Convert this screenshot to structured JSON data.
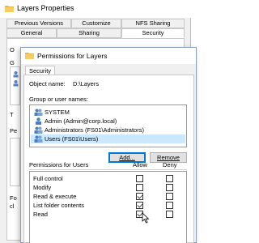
{
  "background_window": {
    "title": "Layers Properties",
    "tabs_row1": [
      "Previous Versions",
      "Customize",
      "NFS Sharing"
    ],
    "tabs_row2": [
      "General",
      "Sharing",
      "Security"
    ],
    "active_tab": "Security",
    "fragments": [
      "O",
      "G",
      "T",
      "Pe",
      "Fo",
      "cl"
    ]
  },
  "dialog": {
    "title": "Permissions for Layers",
    "tab": "Security",
    "object_name_label": "Object name:",
    "object_name_value": "D:\\Layers",
    "group_label": "Group or user names:",
    "principals": [
      "SYSTEM",
      "Admin (Admin@corp.local)",
      "Administrators (FS01\\Administrators)",
      "Users (FS01\\Users)"
    ],
    "selected_principal": "Users (FS01\\Users)",
    "add_button": "Add...",
    "remove_button": "Remove",
    "permissions_label": "Permissions for Users",
    "allow_header": "Allow",
    "deny_header": "Deny",
    "permissions": [
      {
        "name": "Full control",
        "allow": false,
        "deny": false
      },
      {
        "name": "Modify",
        "allow": false,
        "deny": false
      },
      {
        "name": "Read & execute",
        "allow": true,
        "deny": false
      },
      {
        "name": "List folder contents",
        "allow": true,
        "deny": false
      },
      {
        "name": "Read",
        "allow": true,
        "deny": false
      }
    ]
  },
  "colors": {
    "selection": "#cce8ff",
    "accent": "#0078d7",
    "folder": "#e8b84a"
  }
}
